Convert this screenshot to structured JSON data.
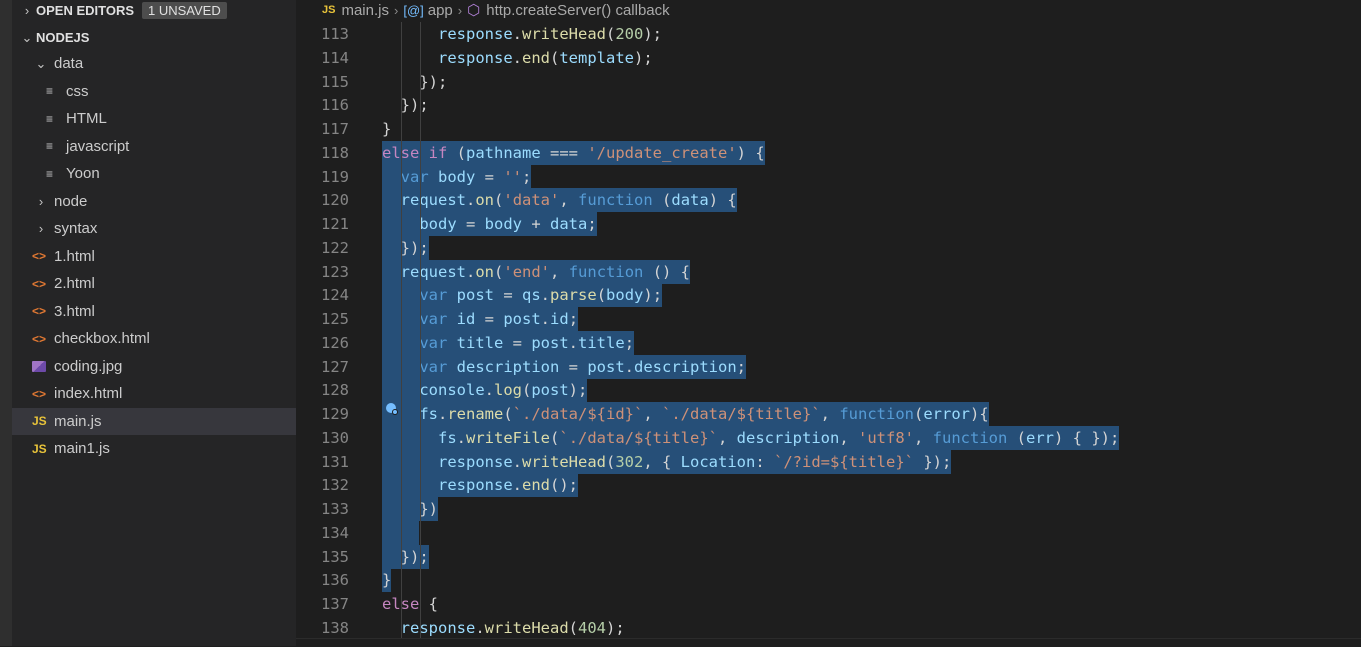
{
  "sidebar": {
    "open_editors": {
      "label": "OPEN EDITORS",
      "badge": "1 UNSAVED"
    },
    "project": {
      "label": "NODEJS"
    },
    "items": [
      {
        "label": "data",
        "kind": "folder-open",
        "icon": "chevron-down-icon",
        "depth": 1
      },
      {
        "label": "css",
        "kind": "file",
        "icon": "lines-file-icon",
        "depth": 2
      },
      {
        "label": "HTML",
        "kind": "file",
        "icon": "lines-file-icon",
        "depth": 2
      },
      {
        "label": "javascript",
        "kind": "file",
        "icon": "lines-file-icon",
        "depth": 2
      },
      {
        "label": "Yoon",
        "kind": "file",
        "icon": "lines-file-icon",
        "depth": 2
      },
      {
        "label": "node",
        "kind": "folder",
        "icon": "chevron-right-icon",
        "depth": 1
      },
      {
        "label": "syntax",
        "kind": "folder",
        "icon": "chevron-right-icon",
        "depth": 1
      },
      {
        "label": "1.html",
        "kind": "html",
        "icon": "html-file-icon",
        "depth": 1
      },
      {
        "label": "2.html",
        "kind": "html",
        "icon": "html-file-icon",
        "depth": 1
      },
      {
        "label": "3.html",
        "kind": "html",
        "icon": "html-file-icon",
        "depth": 1
      },
      {
        "label": "checkbox.html",
        "kind": "html",
        "icon": "html-file-icon",
        "depth": 1
      },
      {
        "label": "coding.jpg",
        "kind": "image",
        "icon": "image-file-icon",
        "depth": 1
      },
      {
        "label": "index.html",
        "kind": "html",
        "icon": "html-file-icon",
        "depth": 1
      },
      {
        "label": "main.js",
        "kind": "js",
        "icon": "js-file-icon",
        "depth": 1,
        "selected": true
      },
      {
        "label": "main1.js",
        "kind": "js",
        "icon": "js-file-icon",
        "depth": 1
      }
    ]
  },
  "breadcrumb": {
    "js_badge": "JS",
    "file": "main.js",
    "symbol1_icon": "[@]",
    "symbol1": "app",
    "symbol2": "http.createServer() callback"
  },
  "code_lines": [
    {
      "n": "113",
      "t": "      response.writeHead(200);",
      "sel": false
    },
    {
      "n": "114",
      "t": "      response.end(template);",
      "sel": false
    },
    {
      "n": "115",
      "t": "    });",
      "sel": false
    },
    {
      "n": "116",
      "t": "  });",
      "sel": false
    },
    {
      "n": "117",
      "t": "}",
      "sel": false
    },
    {
      "n": "118",
      "t": "else if (pathname === '/update_create') {",
      "sel": true
    },
    {
      "n": "119",
      "t": "  var body = '';",
      "sel": true
    },
    {
      "n": "120",
      "t": "  request.on('data', function (data) {",
      "sel": true
    },
    {
      "n": "121",
      "t": "    body = body + data;",
      "sel": true
    },
    {
      "n": "122",
      "t": "  });",
      "sel": true
    },
    {
      "n": "123",
      "t": "  request.on('end', function () {",
      "sel": true
    },
    {
      "n": "124",
      "t": "    var post = qs.parse(body);",
      "sel": true
    },
    {
      "n": "125",
      "t": "    var id = post.id;",
      "sel": true
    },
    {
      "n": "126",
      "t": "    var title = post.title;",
      "sel": true
    },
    {
      "n": "127",
      "t": "    var description = post.description;",
      "sel": true
    },
    {
      "n": "128",
      "t": "    console.log(post);",
      "sel": true
    },
    {
      "n": "129",
      "t": "    fs.rename(`./data/${id}`, `./data/${title}`, function(error){",
      "sel": true
    },
    {
      "n": "130",
      "t": "      fs.writeFile(`./data/${title}`, description, 'utf8', function (err) { });",
      "sel": true
    },
    {
      "n": "131",
      "t": "      response.writeHead(302, { Location: `/?id=${title}` });",
      "sel": true
    },
    {
      "n": "132",
      "t": "      response.end();",
      "sel": true
    },
    {
      "n": "133",
      "t": "    })",
      "sel": true
    },
    {
      "n": "134",
      "t": "    ",
      "sel": true
    },
    {
      "n": "135",
      "t": "  });",
      "sel": true
    },
    {
      "n": "136",
      "t": "}",
      "sel": true
    },
    {
      "n": "137",
      "t": "else {",
      "sel": false
    },
    {
      "n": "138",
      "t": "  response.writeHead(404);",
      "sel": false
    }
  ],
  "colors": {
    "keyword": "#569cd6",
    "control": "#c586c0",
    "string": "#ce9178",
    "function": "#dcdcaa",
    "variable": "#9cdcfe",
    "number": "#b5cea8",
    "selection": "#264f78"
  }
}
